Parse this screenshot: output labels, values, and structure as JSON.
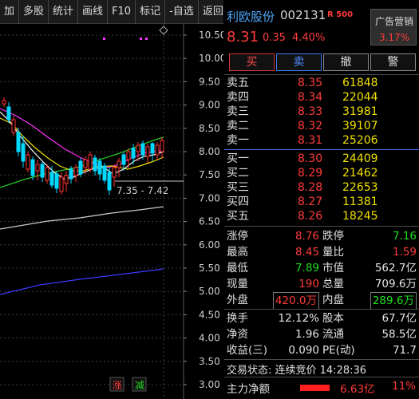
{
  "toolbar": {
    "items": [
      "加",
      "多股",
      "统计",
      "画线",
      "F10",
      "标记",
      "-自选",
      "返回"
    ]
  },
  "chart": {
    "price_labels": [
      "10.50",
      "10.00",
      "9.50",
      "9.00",
      "8.50",
      "8.00",
      "7.50",
      "7.00",
      "6.50",
      "6.00",
      "5.50",
      "5.00",
      "4.50",
      "4.00",
      "3.50",
      "3.00"
    ],
    "range_annotation": "7.35 - 7.42",
    "markers": {
      "rise": "涨",
      "fall": "减"
    },
    "colors": {
      "up": "#ff3333",
      "down": "#00d8ff",
      "ma5": "#ffffff",
      "ma10": "#f0e000",
      "ma20": "#ff30ff",
      "ma60": "#22cc22",
      "ma120": "#c8c8c8",
      "ma250": "#3a3aff"
    }
  },
  "stock": {
    "name": "利欧股份",
    "code": "002131",
    "flag": "R 500",
    "price": "8.31",
    "change": "0.35",
    "change_pct": "4.40%",
    "ad_label": "广告营销",
    "ad_pct": "3.17%"
  },
  "trade_buttons": {
    "buy": "买",
    "sell": "卖",
    "cancel": "撤",
    "alert": "警"
  },
  "order_book": {
    "sells": [
      {
        "label": "卖五",
        "price": "8.35",
        "volume": "61848"
      },
      {
        "label": "卖四",
        "price": "8.34",
        "volume": "22044"
      },
      {
        "label": "卖三",
        "price": "8.33",
        "volume": "31981"
      },
      {
        "label": "卖二",
        "price": "8.32",
        "volume": "39107"
      },
      {
        "label": "卖一",
        "price": "8.31",
        "volume": "25206"
      }
    ],
    "buys": [
      {
        "label": "买一",
        "price": "8.30",
        "volume": "24409"
      },
      {
        "label": "买二",
        "price": "8.29",
        "volume": "21462"
      },
      {
        "label": "买三",
        "price": "8.28",
        "volume": "22653"
      },
      {
        "label": "买四",
        "price": "8.27",
        "volume": "11381"
      },
      {
        "label": "买五",
        "price": "8.26",
        "volume": "18245"
      }
    ]
  },
  "stats": [
    {
      "l1": "涨停",
      "v1": "8.76",
      "c1": "red",
      "l2": "跌停",
      "v2": "7.16",
      "c2": "green"
    },
    {
      "l1": "最高",
      "v1": "8.45",
      "c1": "red",
      "l2": "量比",
      "v2": "1.59",
      "c2": "red"
    },
    {
      "l1": "最低",
      "v1": "7.89",
      "c1": "green",
      "l2": "市值",
      "v2": "562.7亿",
      "c2": "white"
    },
    {
      "l1": "现量",
      "v1": "190",
      "c1": "red",
      "l2": "总量",
      "v2": "709.6万",
      "c2": "white"
    },
    {
      "l1": "外盘",
      "v1": "420.0万",
      "c1": "red",
      "l2": "内盘",
      "v2": "289.6万",
      "c2": "green"
    },
    {
      "l1": "换手",
      "v1": "12.12%",
      "c1": "white",
      "l2": "股本",
      "v2": "67.7亿",
      "c2": "white"
    },
    {
      "l1": "净资",
      "v1": "1.96",
      "c1": "white",
      "l2": "流通",
      "v2": "58.5亿",
      "c2": "white"
    },
    {
      "l1": "收益(三)",
      "v1": "0.090",
      "c1": "white",
      "l2": "PE(动)",
      "v2": "71.7",
      "c2": "white"
    }
  ],
  "trade_status": "交易状态: 连续竞价 14:28:36",
  "net_flow": {
    "label": "主力净额",
    "value": "6.63亿",
    "pct": "11%"
  }
}
